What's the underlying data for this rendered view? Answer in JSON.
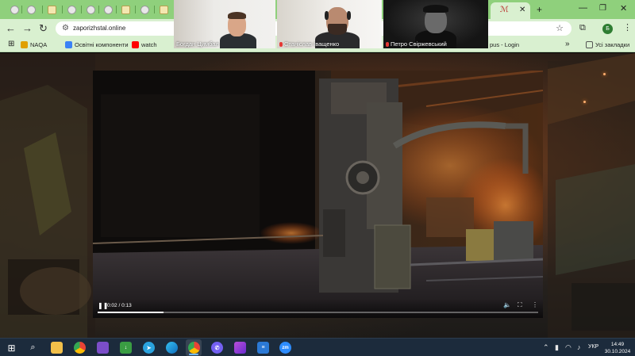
{
  "browser": {
    "url": "zaporizhstal.online",
    "bookmarks": [
      {
        "label": "NAQA",
        "color": "#e0a000"
      },
      {
        "label": "Освітні компоненти",
        "color": "#3b82f6"
      },
      {
        "label": "watch",
        "color": "#ff0000"
      },
      {
        "label": "pus - Login",
        "color": "#888888"
      }
    ],
    "all_bookmarks": "Усі закладки",
    "profile_letter": "Б"
  },
  "video_call": {
    "participants": [
      {
        "name": "Богдан Цимбал",
        "muted": false
      },
      {
        "name": "Станіслав Іващенко",
        "muted": true
      },
      {
        "name": "Петро Свіржевський",
        "muted": true
      }
    ]
  },
  "video_player": {
    "current_time": "0:02",
    "duration": "0:13",
    "time_display": "0:02 / 0:13",
    "progress": 0.15
  },
  "taskbar": {
    "apps": [
      "start",
      "search",
      "file-explorer",
      "chrome",
      "files",
      "download-manager",
      "telegram",
      "edge",
      "chrome-active",
      "viber",
      "app-purple",
      "notepad",
      "zoom"
    ],
    "zoom_label": "zm",
    "telegram_badge": "",
    "language": "УКР",
    "time": "14:49",
    "date": "30.10.2024"
  }
}
